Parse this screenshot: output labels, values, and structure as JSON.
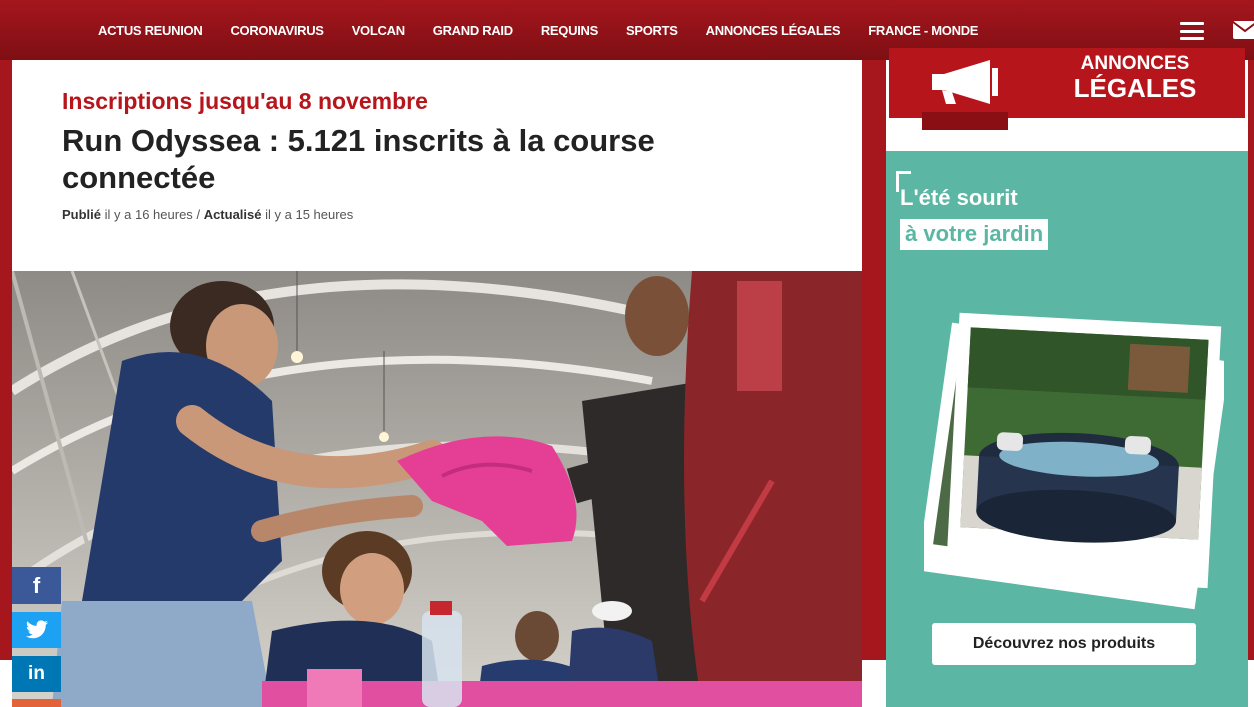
{
  "nav": {
    "items": [
      "ACTUS REUNION",
      "CORONAVIRUS",
      "VOLCAN",
      "GRAND RAID",
      "REQUINS",
      "SPORTS",
      "ANNONCES LÉGALES",
      "FRANCE - MONDE"
    ],
    "menu_icon": "hamburger-menu-icon",
    "mail_icon": "envelope-icon"
  },
  "article": {
    "kicker": "Inscriptions jusqu'au 8 novembre",
    "title": "Run Odyssea : 5.121 inscrits à la course connectée",
    "published_label": "Publié",
    "published_time": "il y a 16 heures",
    "separator": "/",
    "updated_label": "Actualisé",
    "updated_time": "il y a 15 heures"
  },
  "share": {
    "facebook": "f",
    "twitter_icon": "twitter-bird-icon",
    "linkedin": "in"
  },
  "legal_banner": {
    "line1": "ANNONCES",
    "line2": "LÉGALES",
    "icon": "megaphone-icon"
  },
  "ad": {
    "line1": "L'été sourit",
    "line2": "à votre jardin",
    "button": "Découvrez nos produits"
  },
  "colors": {
    "brand_red": "#a5161d",
    "legal_red": "#b7151c",
    "ad_teal": "#5bb6a4",
    "facebook": "#3b5998",
    "twitter": "#1da1f2",
    "linkedin": "#0077b5"
  }
}
